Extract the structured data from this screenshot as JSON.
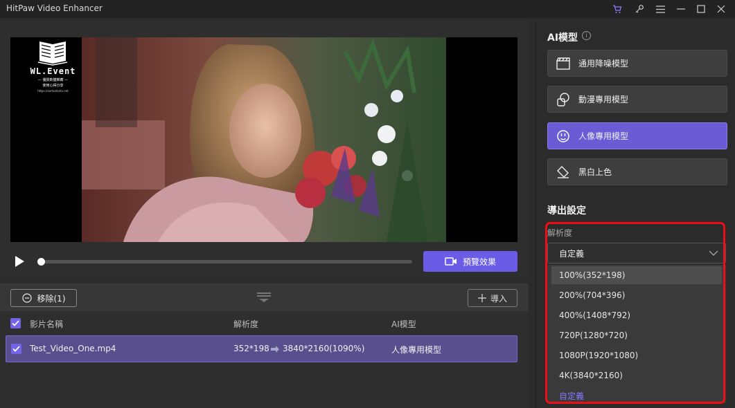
{
  "app": {
    "title": "HitPaw Video Enhancer"
  },
  "titlebar_icons": [
    "cart-icon",
    "key-icon",
    "menu-icon",
    "minimize-icon",
    "maximize-icon",
    "close-icon"
  ],
  "watermark": {
    "title": "WL.Event",
    "line1": "— 優質軟體推薦 —",
    "line2": "使用心得分享",
    "line3": "https://sortsofonts.net"
  },
  "player": {
    "progress": 0,
    "preview_button": "預覽效果"
  },
  "list": {
    "remove_button": "移除(1)",
    "import_button": "導入",
    "headers": {
      "name": "影片名稱",
      "resolution": "解析度",
      "model": "AI模型"
    },
    "rows": [
      {
        "name": "Test_Video_One.mp4",
        "source_res": "352*198",
        "target_res": "3840*2160(1090%)",
        "model": "人像專用模型",
        "checked": true
      }
    ]
  },
  "ai_model": {
    "title": "AI模型",
    "models": [
      {
        "label": "通用降噪模型",
        "icon": "clapperboard-icon"
      },
      {
        "label": "動漫專用模型",
        "icon": "anime-icon"
      },
      {
        "label": "人像專用模型",
        "icon": "face-icon",
        "active": true
      },
      {
        "label": "黑白上色",
        "icon": "paint-bucket-icon"
      }
    ]
  },
  "export": {
    "title": "導出設定",
    "resolution_label": "解析度",
    "selected": "自定義",
    "options": [
      "100%(352*198)",
      "200%(704*396)",
      "400%(1408*792)",
      "720P(1280*720)",
      "1080P(1920*1080)",
      "4K(3840*2160)",
      "自定義"
    ]
  },
  "colors": {
    "accent": "#6b5ce7",
    "highlight": "#ee0f14"
  }
}
